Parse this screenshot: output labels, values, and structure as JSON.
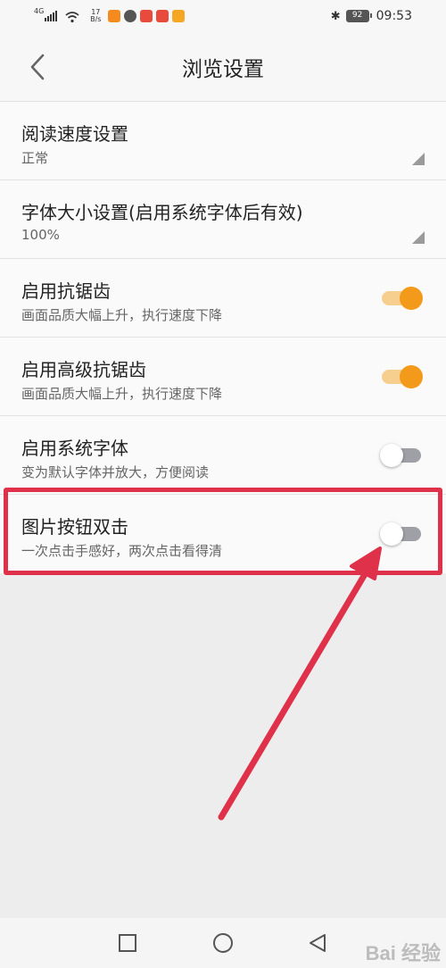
{
  "status_bar": {
    "network": "4G",
    "speed_value": "17",
    "speed_unit": "B/s",
    "battery": "92",
    "time": "09:53",
    "app_icon_colors": [
      "#f58a1f",
      "#555555",
      "#e84b3c",
      "#e84b3c",
      "#f5a623"
    ]
  },
  "header": {
    "title": "浏览设置",
    "back_icon": "chevron-left-icon"
  },
  "settings": [
    {
      "key": "reading-speed",
      "title": "阅读速度设置",
      "value": "正常",
      "control": "dropdown"
    },
    {
      "key": "font-size",
      "title": "字体大小设置(启用系统字体后有效)",
      "value": "100%",
      "control": "dropdown"
    },
    {
      "key": "antialias",
      "title": "启用抗锯齿",
      "subtitle": "画面品质大幅上升，执行速度下降",
      "control": "toggle",
      "on": true
    },
    {
      "key": "advanced-antialias",
      "title": "启用高级抗锯齿",
      "subtitle": "画面品质大幅上升，执行速度下降",
      "control": "toggle",
      "on": true
    },
    {
      "key": "system-font",
      "title": "启用系统字体",
      "subtitle": "变为默认字体并放大，方便阅读",
      "control": "toggle",
      "on": false
    },
    {
      "key": "image-double-tap",
      "title": "图片按钮双击",
      "subtitle": "一次点击手感好，两次点击看得清",
      "control": "toggle",
      "on": false
    }
  ],
  "colors": {
    "toggle_on": "#f49a1a",
    "annotation": "#e0314b"
  },
  "nav_bar": {
    "icons": [
      "square-icon",
      "circle-icon",
      "triangle-back-icon"
    ]
  },
  "watermark": "Bai 经验"
}
